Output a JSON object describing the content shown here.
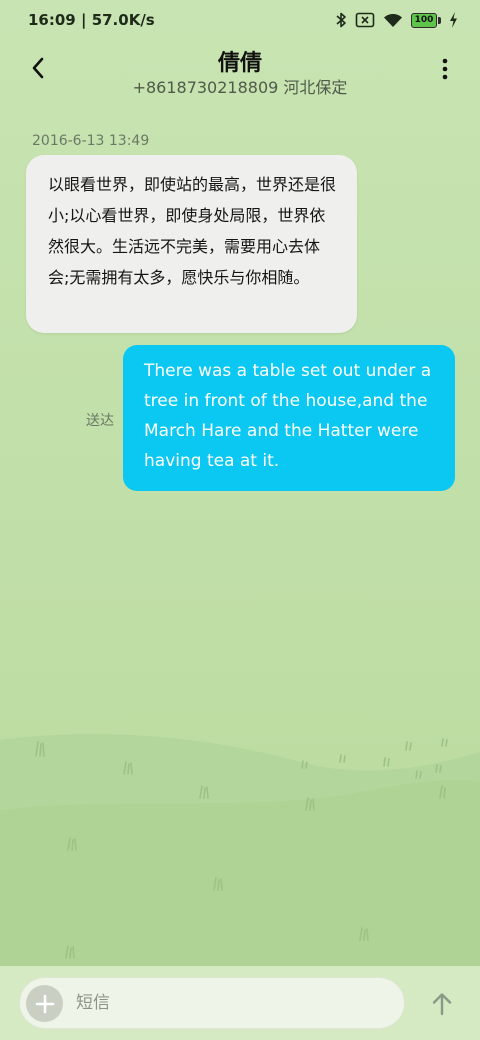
{
  "status_bar": {
    "time": "16:09",
    "network_speed": "57.0K/s",
    "battery_level": "100",
    "icons": [
      "bluetooth-icon",
      "sim-no-signal-icon",
      "wifi-icon",
      "battery-icon",
      "charging-icon"
    ]
  },
  "header": {
    "contact_name": "倩倩",
    "contact_number": "+8618730218809",
    "contact_location": "河北保定",
    "back_icon": "chevron-left-icon",
    "more_icon": "more-vertical-icon"
  },
  "conversation": {
    "timestamp": "2016-6-13 13:49",
    "received_message": "以眼看世界，即使站的最高，世界还是很小;以心看世界，即使身处局限，世界依然很大。生活远不完美，需要用心去体会;无需拥有太多，愿快乐与你相随。",
    "sent_message": "There was a table set out under a tree in front of the house,and the March Hare and the Hatter were having tea at it.",
    "sent_status": "送达"
  },
  "composer": {
    "placeholder": "短信",
    "add_icon": "plus-icon",
    "send_icon": "arrow-up-icon"
  },
  "colors": {
    "background": "#c4e1ad",
    "received_bubble": "#eff0ee",
    "sent_bubble": "#0bc8f2",
    "composer_bar": "#d5e9c3"
  }
}
